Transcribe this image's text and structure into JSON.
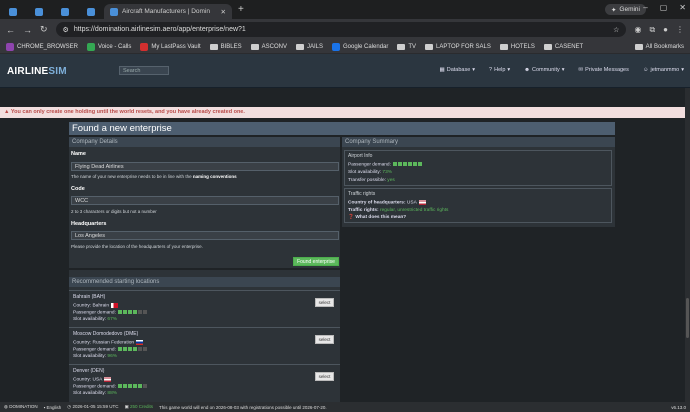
{
  "browser": {
    "tab_title": "Aircraft Manufacturers | Domin",
    "url": "https://domination.airlinesim.aero/app/enterprise/new?1",
    "gemini_label": "Gemini",
    "bookmarks": [
      "CHROME_BROWSER",
      "Voice - Calls",
      "My LastPass Vault",
      "BIBLES",
      "ASCONV",
      "JAILS",
      "Google Calendar",
      "TV",
      "LAPTOP FOR SALS",
      "HOTELS",
      "CASENET"
    ],
    "all_bookmarks": "All Bookmarks"
  },
  "site": {
    "logo_a": "AIRLINE",
    "logo_b": "SIM",
    "search_placeholder": "Search",
    "nav": [
      "Database",
      "Help",
      "Community",
      "Private Messages",
      "jetmanmmo"
    ]
  },
  "error_banner": "You can only create one holding until the world resets, and you have already created one.",
  "page_title": "Found a new enterprise",
  "company_details": {
    "heading": "Company Details",
    "name_label": "Name",
    "name_value": "Flying Dead Airlines",
    "name_hint": "The name of your new enterprise needs to be in line with the",
    "name_hint_link": "naming conventions",
    "code_label": "Code",
    "code_value": "WCC",
    "code_hint": "2 to 3 characters or digits but not a number",
    "hq_label": "Headquarters",
    "hq_value": "Los Angeles",
    "hq_hint": "Please provide the location of the headquarters of your enterprise.",
    "found_button": "Found enterprise"
  },
  "recommended": {
    "heading": "Recommended starting locations",
    "country_label": "Country:",
    "demand_label": "Passenger demand:",
    "slot_label": "Slot availability:",
    "select_label": "select",
    "items": [
      {
        "name": "Bahrain (BAH)",
        "country": "Bahrain",
        "demand": 0.7,
        "slot": "67%"
      },
      {
        "name": "Moscow Domodedovo (DME)",
        "country": "Russian Federation",
        "demand": 0.7,
        "slot": "96%"
      },
      {
        "name": "Denver (DEN)",
        "country": "USA",
        "demand": 0.85,
        "slot": "88%"
      }
    ]
  },
  "company_summary": {
    "heading": "Company Summary",
    "airport_info": "Airport Info",
    "passenger_demand_label": "Passenger demand:",
    "passenger_demand": 1.0,
    "slot_label": "Slot availability:",
    "slot_value": "73%",
    "transfer_label": "Transfer possible:",
    "transfer_value": "yes",
    "traffic_rights": "Traffic rights",
    "country_hq_label": "Country of headquarters:",
    "country_hq_value": "USA",
    "traffic_rights_label": "Traffic rights:",
    "traffic_rights_value": "regular, unrestricted traffic rights",
    "what_mean": "What does this mean?"
  },
  "status_bar": {
    "world": "DOMINATION",
    "language": "English",
    "datetime": "2026-01-05 15:59 UTC",
    "credits": "250 Credits",
    "notice": "This game world will end on 2026-08-03 with registrations possible until 2026-07-20.",
    "version": "v6.13.0"
  },
  "colors": {
    "accent_green": "#5cb85c",
    "title_bar": "#4d5e70",
    "error_bg": "#f2dede"
  }
}
